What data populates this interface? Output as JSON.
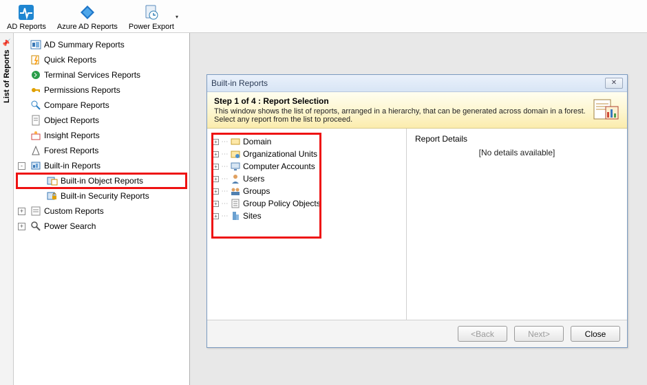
{
  "toolbar": {
    "ad_reports": "AD Reports",
    "azure_ad_reports": "Azure AD Reports",
    "power_export": "Power Export"
  },
  "side_tab": {
    "label": "List of Reports"
  },
  "tree": [
    {
      "label": "AD Summary Reports",
      "level": 0,
      "exp": null,
      "icon": "summary",
      "highlight": false
    },
    {
      "label": "Quick Reports",
      "level": 0,
      "exp": null,
      "icon": "quick",
      "highlight": false
    },
    {
      "label": "Terminal Services Reports",
      "level": 0,
      "exp": null,
      "icon": "terminal",
      "highlight": false
    },
    {
      "label": "Permissions Reports",
      "level": 0,
      "exp": null,
      "icon": "permissions",
      "highlight": false
    },
    {
      "label": "Compare Reports",
      "level": 0,
      "exp": null,
      "icon": "compare",
      "highlight": false
    },
    {
      "label": "Object Reports",
      "level": 0,
      "exp": null,
      "icon": "object",
      "highlight": false
    },
    {
      "label": "Insight Reports",
      "level": 0,
      "exp": null,
      "icon": "insight",
      "highlight": false
    },
    {
      "label": "Forest Reports",
      "level": 0,
      "exp": null,
      "icon": "forest",
      "highlight": false
    },
    {
      "label": "Built-in Reports",
      "level": 0,
      "exp": "-",
      "icon": "builtin",
      "highlight": false
    },
    {
      "label": "Built-in Object Reports",
      "level": 1,
      "exp": null,
      "icon": "builtin-obj",
      "highlight": true
    },
    {
      "label": "Built-in Security Reports",
      "level": 1,
      "exp": null,
      "icon": "builtin-sec",
      "highlight": false
    },
    {
      "label": "Custom Reports",
      "level": 0,
      "exp": "+",
      "icon": "custom",
      "highlight": false
    },
    {
      "label": "Power Search",
      "level": 0,
      "exp": "+",
      "icon": "search",
      "highlight": false
    }
  ],
  "dialog": {
    "title": "Built-in Reports",
    "step": "Step 1 of 4  : Report Selection",
    "desc": "This window shows the list of reports, arranged in a hierarchy, that can be generated across domain in a forest. Select any report from the list to proceed.",
    "nodes": [
      {
        "label": "Domain",
        "icon": "domain"
      },
      {
        "label": "Organizational Units",
        "icon": "ou"
      },
      {
        "label": "Computer Accounts",
        "icon": "computer"
      },
      {
        "label": "Users",
        "icon": "user"
      },
      {
        "label": "Groups",
        "icon": "group"
      },
      {
        "label": "Group Policy Objects",
        "icon": "gpo"
      },
      {
        "label": "Sites",
        "icon": "site"
      }
    ],
    "details_title": "Report Details",
    "details_msg": "[No details available]",
    "buttons": {
      "back": "<Back",
      "next": "Next>",
      "close": "Close"
    }
  }
}
